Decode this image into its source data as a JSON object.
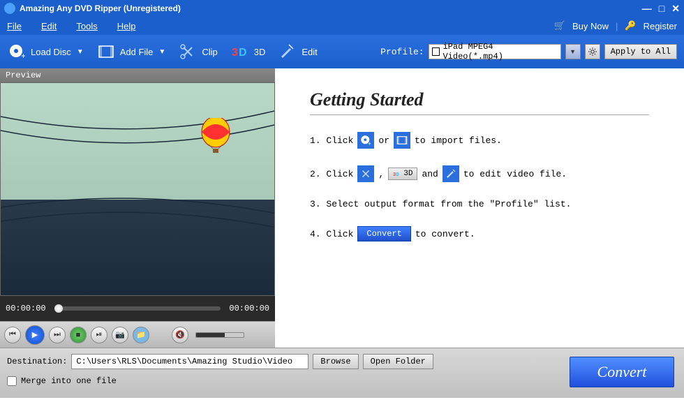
{
  "titlebar": {
    "title": "Amazing Any DVD Ripper (Unregistered)"
  },
  "menubar": {
    "items": [
      "File",
      "Edit",
      "Tools",
      "Help"
    ],
    "buy_now": "Buy Now",
    "register": "Register"
  },
  "toolbar": {
    "load_disc": "Load Disc",
    "add_file": "Add File",
    "clip": "Clip",
    "three_d": "3D",
    "edit": "Edit",
    "profile_label": "Profile:",
    "profile_value": "iPad MPEG4 Video(*.mp4)",
    "apply_all": "Apply to All"
  },
  "preview": {
    "label": "Preview",
    "time_start": "00:00:00",
    "time_end": "00:00:00"
  },
  "getting_started": {
    "title": "Getting Started",
    "step1_a": "1. Click",
    "step1_or": "or",
    "step1_b": "to import files.",
    "step2_a": "2. Click",
    "step2_comma": ",",
    "step2_3d": "3D",
    "step2_and": "and",
    "step2_b": "to edit video file.",
    "step3": "3. Select output format from the \"Profile\" list.",
    "step4_a": "4. Click",
    "step4_convert": "Convert",
    "step4_b": "to convert."
  },
  "bottom": {
    "destination_label": "Destination:",
    "destination_value": "C:\\Users\\RLS\\Documents\\Amazing Studio\\Video",
    "browse": "Browse",
    "open_folder": "Open Folder",
    "merge_label": "Merge into one file",
    "convert": "Convert"
  }
}
